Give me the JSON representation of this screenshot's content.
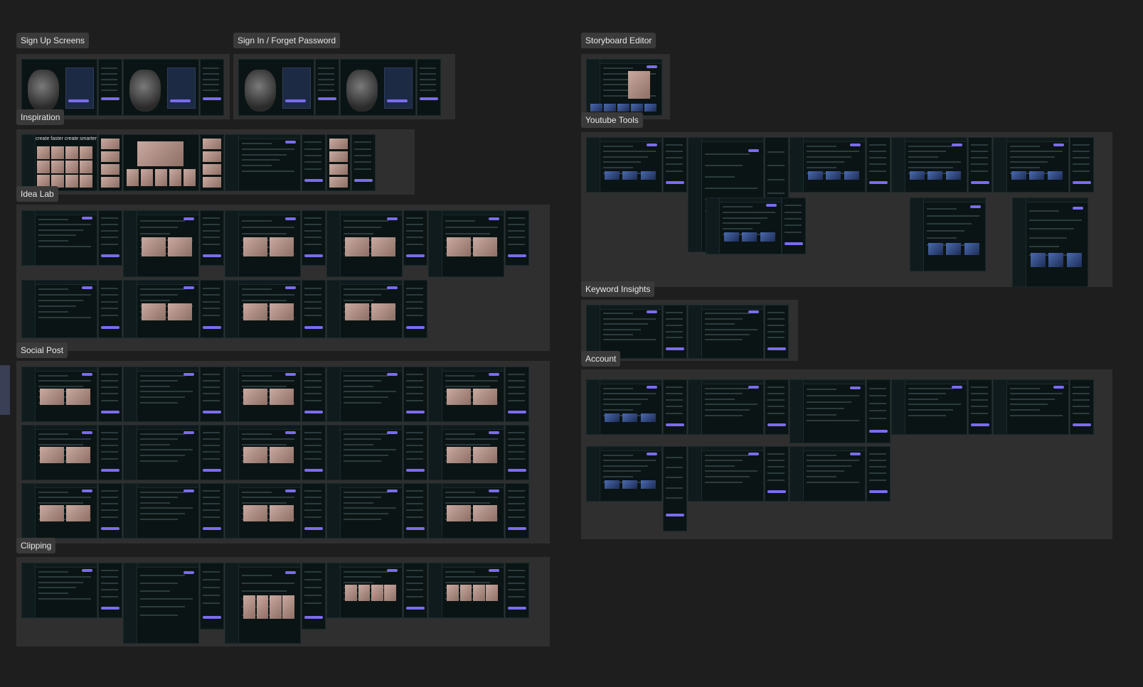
{
  "canvas": {
    "background": "#1e1e1e"
  },
  "sections": [
    {
      "id": "sign-up-screens",
      "title": "Sign Up Screens"
    },
    {
      "id": "sign-in-forget-password",
      "title": "Sign In / Forget Password"
    },
    {
      "id": "inspiration",
      "title": "Inspiration",
      "hero_text": "create faster create smarter"
    },
    {
      "id": "idea-lab",
      "title": "Idea Lab"
    },
    {
      "id": "social-post",
      "title": "Social Post"
    },
    {
      "id": "clipping",
      "title": "Clipping"
    },
    {
      "id": "storyboard-editor",
      "title": "Storyboard Editor"
    },
    {
      "id": "youtube-tools",
      "title": "Youtube Tools"
    },
    {
      "id": "keyword-insights",
      "title": "Keyword Insights"
    },
    {
      "id": "account",
      "title": "Account"
    }
  ],
  "colors": {
    "section": "#2f2f2f",
    "label_bg": "#3a3a3a",
    "frame": "#0b1414",
    "accent": "#7b6cf0"
  }
}
